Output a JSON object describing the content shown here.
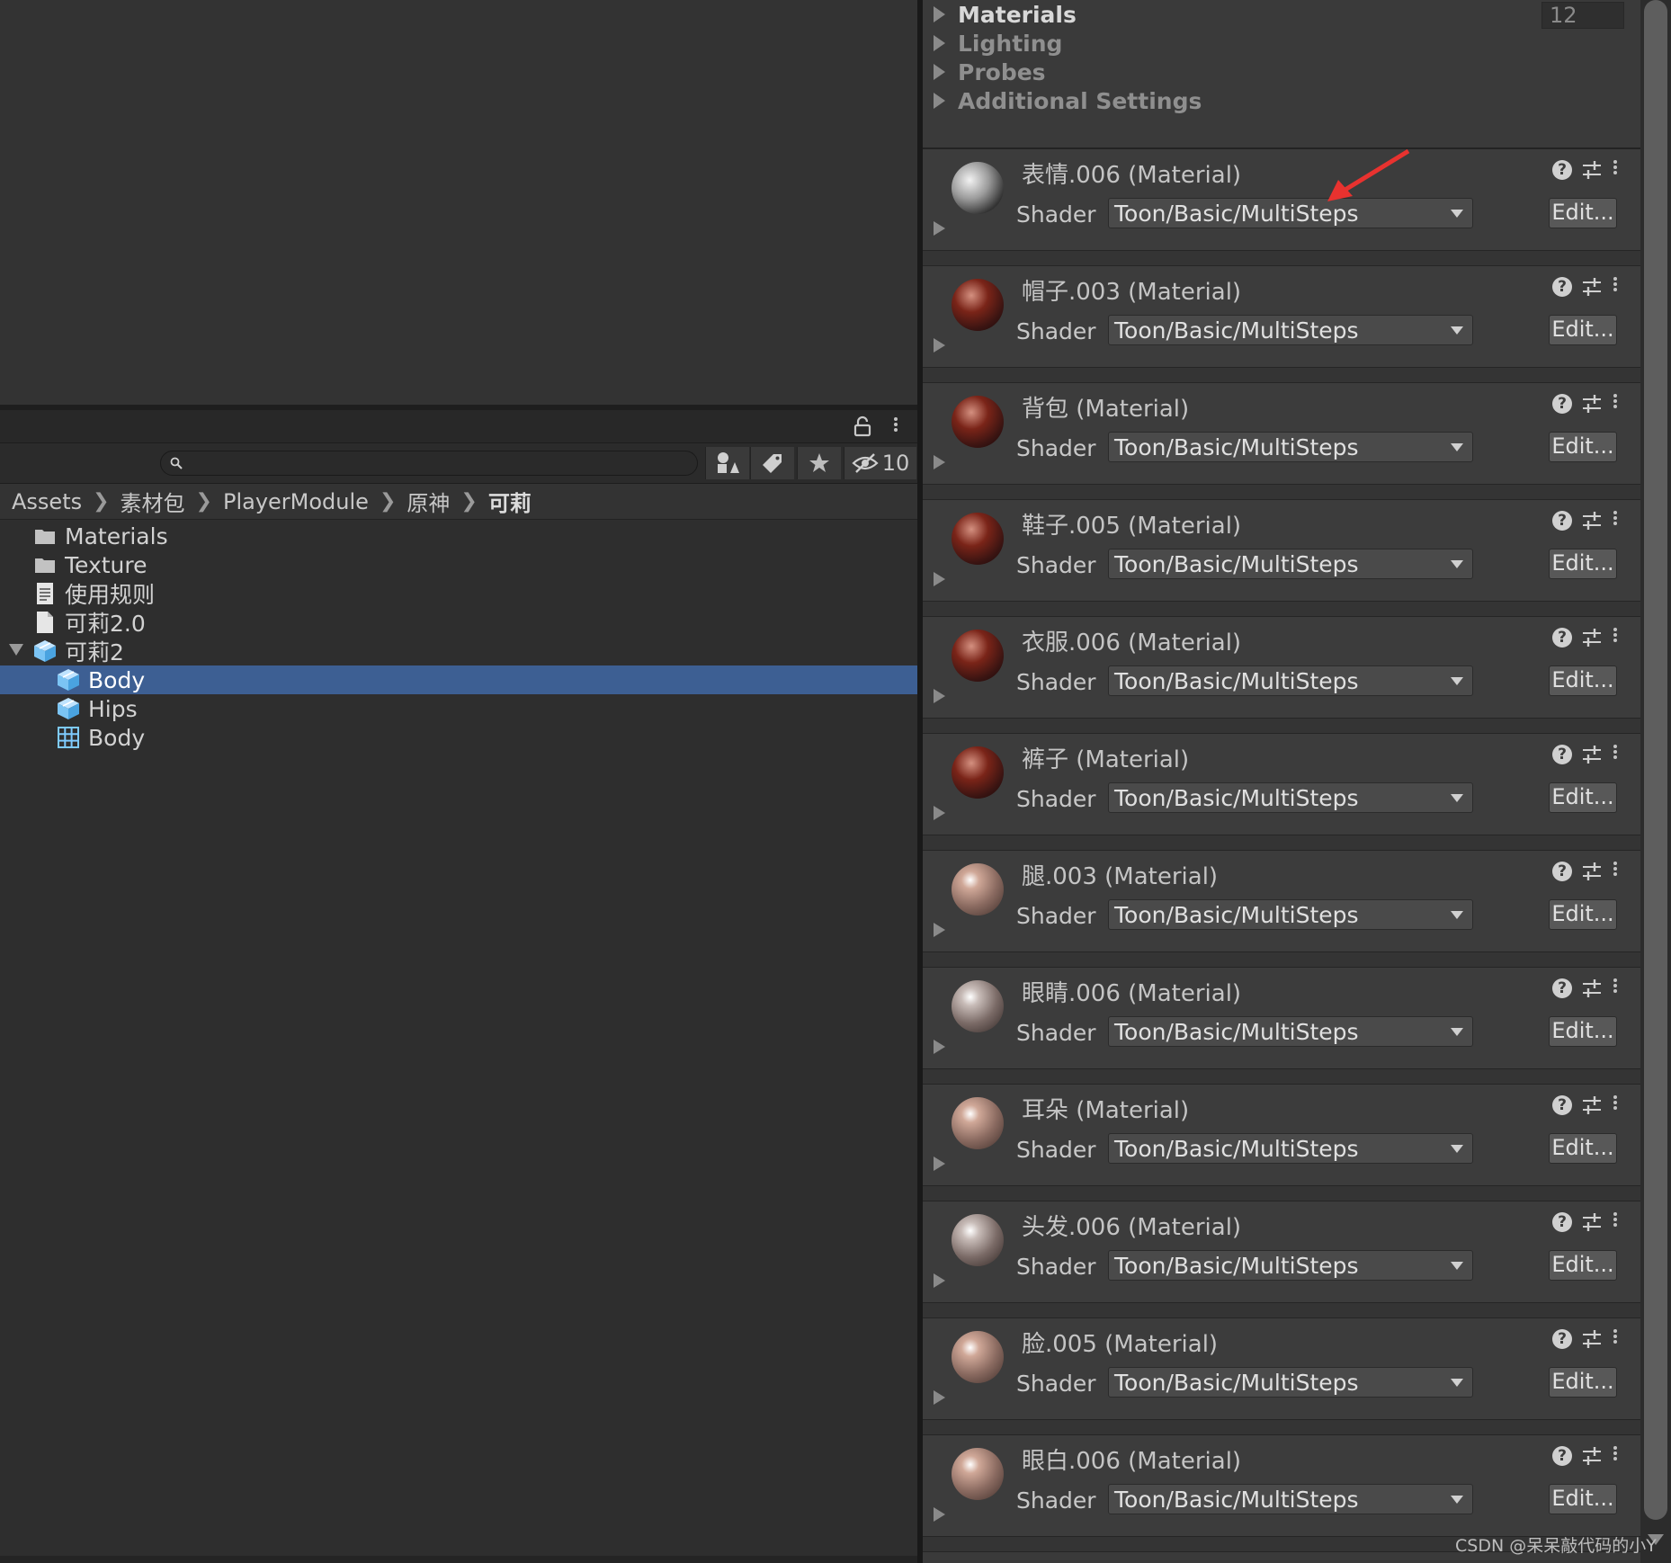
{
  "window": {
    "title": ""
  },
  "project": {
    "toolbar": {
      "hidden_count": "10"
    },
    "breadcrumb": [
      "Assets",
      "素材包",
      "PlayerModule",
      "原神",
      "可莉"
    ],
    "tree": [
      {
        "label": "Materials",
        "icon": "folder-icon",
        "depth": 0
      },
      {
        "label": "Texture",
        "icon": "folder-icon",
        "depth": 0
      },
      {
        "label": "使用规则",
        "icon": "text-file-icon",
        "depth": 0
      },
      {
        "label": "可莉2.0",
        "icon": "file-icon",
        "depth": 0
      },
      {
        "label": "可莉2",
        "icon": "prefab-icon",
        "depth": 0
      },
      {
        "label": "Body",
        "icon": "prefab-icon",
        "depth": 1,
        "selected": true
      },
      {
        "label": "Hips",
        "icon": "prefab-icon",
        "depth": 1
      },
      {
        "label": "Body",
        "icon": "mesh-icon",
        "depth": 1
      }
    ]
  },
  "inspector": {
    "sections": [
      {
        "label": "Materials",
        "active": true
      },
      {
        "label": "Lighting",
        "active": false
      },
      {
        "label": "Probes",
        "active": false
      },
      {
        "label": "Additional Settings",
        "active": false
      }
    ],
    "materials_count": "12",
    "shader_label": "Shader",
    "edit_label": "Edit...",
    "materials": [
      {
        "title": "表情.006 (Material)",
        "shader": "Toon/Basic/MultiSteps",
        "preview": "t0"
      },
      {
        "title": "帽子.003 (Material)",
        "shader": "Toon/Basic/MultiSteps",
        "preview": "t1"
      },
      {
        "title": "背包 (Material)",
        "shader": "Toon/Basic/MultiSteps",
        "preview": "t1"
      },
      {
        "title": "鞋子.005 (Material)",
        "shader": "Toon/Basic/MultiSteps",
        "preview": "t1"
      },
      {
        "title": "衣服.006 (Material)",
        "shader": "Toon/Basic/MultiSteps",
        "preview": "t1"
      },
      {
        "title": "裤子 (Material)",
        "shader": "Toon/Basic/MultiSteps",
        "preview": "t1"
      },
      {
        "title": "腿.003 (Material)",
        "shader": "Toon/Basic/MultiSteps",
        "preview": "t2"
      },
      {
        "title": "眼睛.006 (Material)",
        "shader": "Toon/Basic/MultiSteps",
        "preview": "t3"
      },
      {
        "title": "耳朵 (Material)",
        "shader": "Toon/Basic/MultiSteps",
        "preview": "t2"
      },
      {
        "title": "头发.006 (Material)",
        "shader": "Toon/Basic/MultiSteps",
        "preview": "t3"
      },
      {
        "title": "脸.005 (Material)",
        "shader": "Toon/Basic/MultiSteps",
        "preview": "t2"
      },
      {
        "title": "眼白.006 (Material)",
        "shader": "Toon/Basic/MultiSteps",
        "preview": "t2"
      }
    ]
  },
  "watermark": "CSDN @呆呆敲代码的小Y",
  "colors": {
    "selection": "#3d5f93",
    "annotation_arrow": "#e8322f"
  }
}
